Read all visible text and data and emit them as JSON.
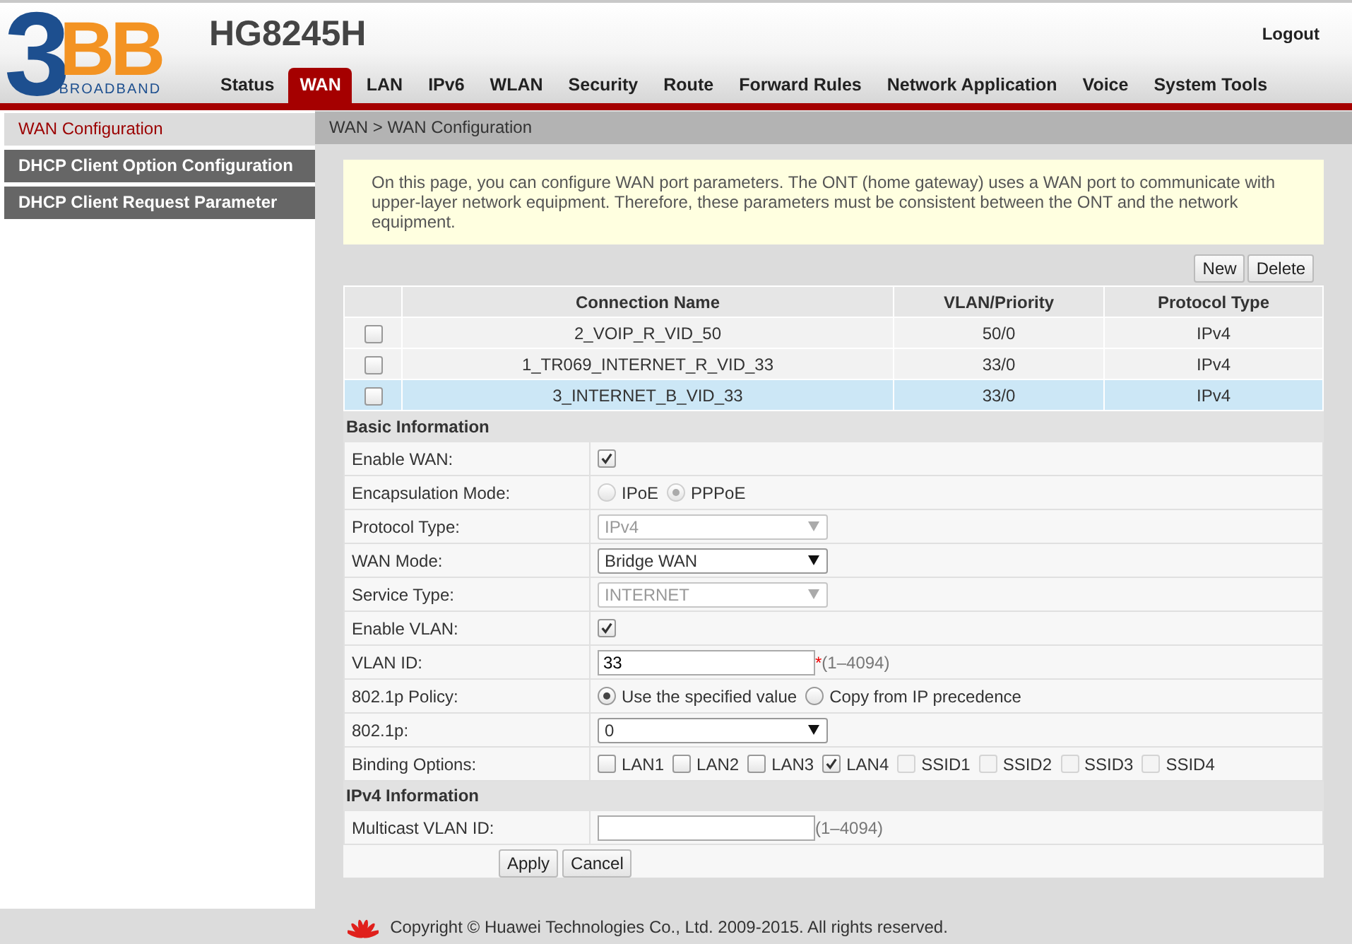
{
  "logo": {
    "numeral": "3",
    "letters": "BB",
    "tagline": "BROADBAND"
  },
  "product": "HG8245H",
  "logout": "Logout",
  "nav": [
    {
      "label": "Status",
      "selected": false
    },
    {
      "label": "WAN",
      "selected": true
    },
    {
      "label": "LAN",
      "selected": false
    },
    {
      "label": "IPv6",
      "selected": false
    },
    {
      "label": "WLAN",
      "selected": false
    },
    {
      "label": "Security",
      "selected": false
    },
    {
      "label": "Route",
      "selected": false
    },
    {
      "label": "Forward Rules",
      "selected": false
    },
    {
      "label": "Network Application",
      "selected": false
    },
    {
      "label": "Voice",
      "selected": false
    },
    {
      "label": "System Tools",
      "selected": false
    }
  ],
  "sidebar": {
    "items": [
      {
        "label": "WAN Configuration",
        "selected": true
      },
      {
        "label": "DHCP Client Option Configuration",
        "selected": false
      },
      {
        "label": "DHCP Client Request Parameter",
        "selected": false
      }
    ]
  },
  "breadcrumb": "WAN > WAN Configuration",
  "notice": "On this page, you can configure WAN port parameters. The ONT (home gateway) uses a WAN port to communicate with upper-layer network equipment. Therefore, these parameters must be consistent between the ONT and the network equipment.",
  "toolbar": [
    "New",
    "Delete"
  ],
  "connections": {
    "columns": [
      "Connection Name",
      "VLAN/Priority",
      "Protocol Type"
    ],
    "rows": [
      {
        "checked": false,
        "selected": false,
        "cells": [
          "2_VOIP_R_VID_50",
          "50/0",
          "IPv4"
        ]
      },
      {
        "checked": false,
        "selected": false,
        "cells": [
          "1_TR069_INTERNET_R_VID_33",
          "33/0",
          "IPv4"
        ]
      },
      {
        "checked": false,
        "selected": true,
        "cells": [
          "3_INTERNET_B_VID_33",
          "33/0",
          "IPv4"
        ]
      }
    ]
  },
  "sections": [
    {
      "title": "Basic Information",
      "rows": [
        {
          "label": "Enable WAN:",
          "kind": "checkbox",
          "checked": true
        },
        {
          "label": "Encapsulation Mode:",
          "kind": "radio",
          "disabled": true,
          "options": [
            {
              "label": "IPoE",
              "selected": false
            },
            {
              "label": "PPPoE",
              "selected": true
            }
          ]
        },
        {
          "label": "Protocol Type:",
          "kind": "select",
          "value": "IPv4",
          "disabled": true
        },
        {
          "label": "WAN Mode:",
          "kind": "select",
          "value": "Bridge WAN",
          "disabled": false
        },
        {
          "label": "Service Type:",
          "kind": "select",
          "value": "INTERNET",
          "disabled": true
        },
        {
          "label": "Enable VLAN:",
          "kind": "checkbox",
          "checked": true
        },
        {
          "label": "VLAN ID:",
          "kind": "input",
          "value": "33",
          "required_mark": "*",
          "hint": "(1–4094)"
        },
        {
          "label": "802.1p Policy:",
          "kind": "radio",
          "disabled": false,
          "options": [
            {
              "label": "Use the specified value",
              "selected": true
            },
            {
              "label": "Copy from IP precedence",
              "selected": false
            }
          ]
        },
        {
          "label": "802.1p:",
          "kind": "select",
          "value": "0",
          "disabled": false
        },
        {
          "label": "Binding Options:",
          "kind": "checkgroup",
          "options": [
            {
              "label": "LAN1",
              "checked": false,
              "disabled": false
            },
            {
              "label": "LAN2",
              "checked": false,
              "disabled": false
            },
            {
              "label": "LAN3",
              "checked": false,
              "disabled": false
            },
            {
              "label": "LAN4",
              "checked": true,
              "disabled": false
            },
            {
              "label": "SSID1",
              "checked": false,
              "disabled": true
            },
            {
              "label": "SSID2",
              "checked": false,
              "disabled": true
            },
            {
              "label": "SSID3",
              "checked": false,
              "disabled": true
            },
            {
              "label": "SSID4",
              "checked": false,
              "disabled": true
            }
          ]
        }
      ]
    },
    {
      "title": "IPv4 Information",
      "rows": [
        {
          "label": "Multicast VLAN ID:",
          "kind": "input",
          "hint": "(1–4094)"
        }
      ]
    }
  ],
  "actions": [
    "Apply",
    "Cancel"
  ],
  "footer": {
    "copyright": "Copyright © Huawei Technologies Co., Ltd. 2009-2015. All rights reserved."
  }
}
